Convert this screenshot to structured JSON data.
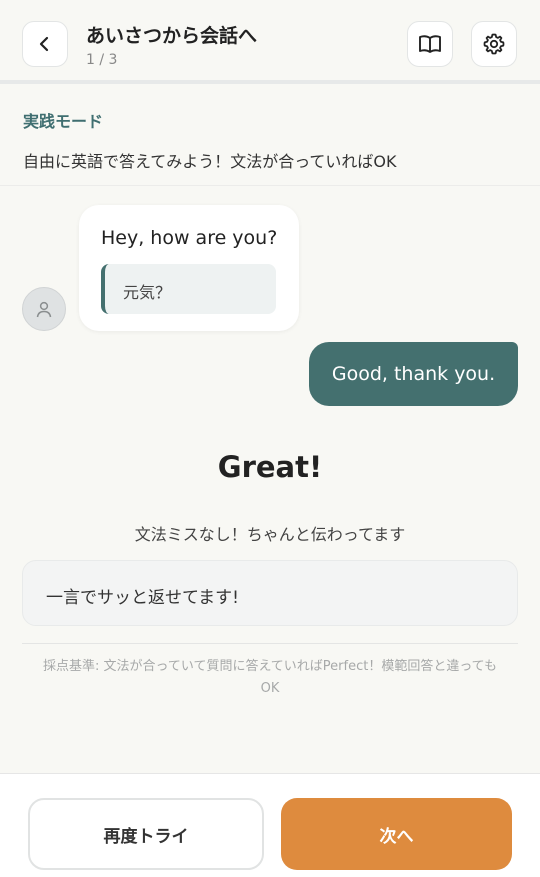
{
  "header": {
    "title": "あいさつから会話へ",
    "counter": "1 / 3",
    "back_icon": "chevron-left",
    "book_icon": "open-book",
    "settings_icon": "gear"
  },
  "mode": {
    "label": "実践モード",
    "description": "自由に英語で答えてみよう！文法が合っていればOK"
  },
  "chat": {
    "incoming": {
      "avatar_icon": "user",
      "text": "Hey, how are you?",
      "translation": "元気？"
    },
    "outgoing": {
      "text": "Good, thank you."
    }
  },
  "result": {
    "title": "Great!",
    "subtitle": "文法ミスなし！ちゃんと伝わってます",
    "feedback": "一言でサッと返せてます!",
    "criteria": "採点基準: 文法が合っていて質問に答えていればPerfect！模範回答と違ってもOK"
  },
  "footer": {
    "retry_label": "再度トライ",
    "next_label": "次へ"
  },
  "colors": {
    "background": "#f8f8f4",
    "accent_teal": "#44706f",
    "accent_orange": "#de8b3e",
    "mode_label": "#3f6e70"
  }
}
